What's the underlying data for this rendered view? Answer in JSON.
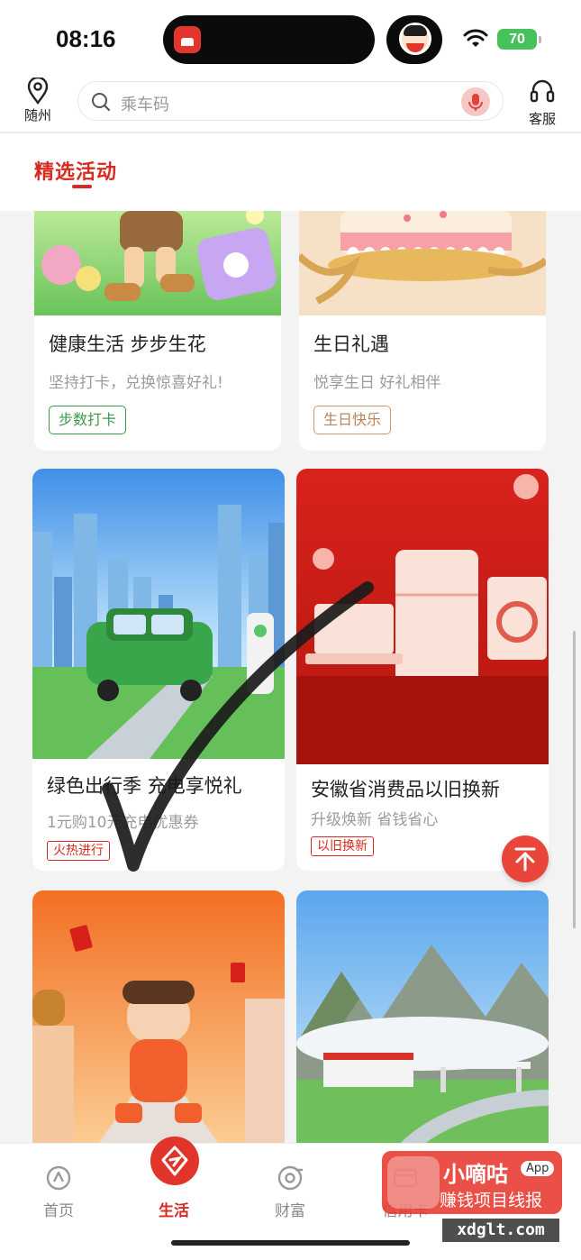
{
  "status_bar": {
    "time": "08:16",
    "battery": "70"
  },
  "header": {
    "location": "随州",
    "search_placeholder": "乘车码",
    "service": "客服"
  },
  "section": {
    "title": "精选活动"
  },
  "cards": [
    {
      "title": "健康生活 步步生花",
      "subtitle": "坚持打卡，兑换惊喜好礼!",
      "tag": "步数打卡",
      "tag_color": "#3c9a4a"
    },
    {
      "title": "生日礼遇",
      "subtitle": "悦享生日 好礼相伴",
      "tag": "生日快乐",
      "tag_color": "#b7835a"
    },
    {
      "title": "绿色出行季 充电享悦礼",
      "subtitle": "1元购10元充电优惠券",
      "tag": "火热进行",
      "tag_color": "#d72a20"
    },
    {
      "title": "安徽省消费品以旧换新",
      "subtitle": "升级焕新 省钱省心",
      "tag": "以旧换新",
      "tag_color": "#d72a20"
    }
  ],
  "tabs": [
    {
      "label": "首页",
      "icon": "home-icon"
    },
    {
      "label": "生活",
      "icon": "life-icon"
    },
    {
      "label": "财富",
      "icon": "wealth-icon"
    },
    {
      "label": "信用卡",
      "icon": "credit-card-icon"
    }
  ],
  "watermark": {
    "name": "小嘀咕",
    "badge": "App",
    "slogan": "赚钱项目线报",
    "url": "xdglt.com"
  },
  "colors": {
    "brand_red": "#d72a20",
    "tag_green": "#3c9a4a",
    "tag_brown": "#b7835a"
  }
}
